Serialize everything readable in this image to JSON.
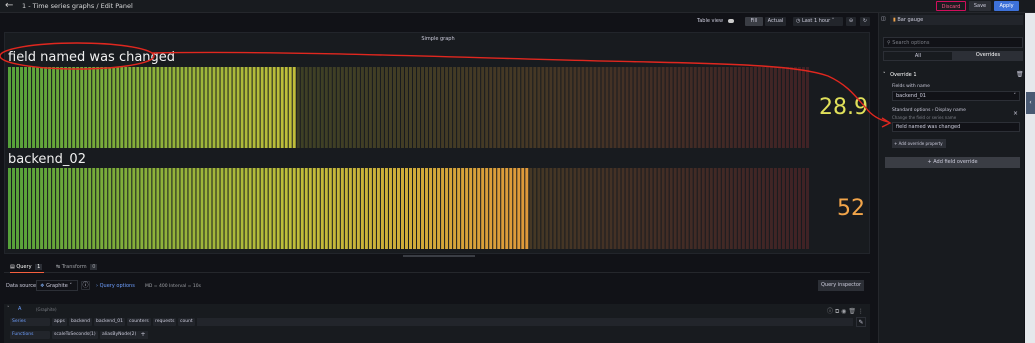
{
  "header": {
    "title": "1 - Time series graphs / Edit Panel",
    "discard": "Discard",
    "save": "Save",
    "apply": "Apply"
  },
  "toolbar": {
    "table_view": "Table view",
    "fill": "Fill",
    "actual": "Actual",
    "time_range": "Last 1 hour"
  },
  "panel": {
    "title": "Simple graph",
    "gauges": [
      {
        "label": "field named was changed",
        "value": "28.9",
        "value_color": "#e0e05a",
        "fill_fraction": 0.36
      },
      {
        "label": "backend_02",
        "value": "52",
        "value_color": "#f2a54a",
        "fill_fraction": 0.65
      }
    ]
  },
  "query_tabs": {
    "query": "Query",
    "query_count": "1",
    "transform": "Transform",
    "transform_count": "0"
  },
  "query": {
    "datasource_label": "Data source",
    "datasource": "Graphite",
    "query_options": "Query options",
    "md": "MD = 400",
    "interval": "Interval = 10s",
    "inspector": "Query inspector",
    "ref": "A",
    "ref_type": "(Graphite)",
    "series_label": "Series",
    "series": [
      "apps",
      "backend",
      "backend_01",
      "counters",
      "requests",
      "count"
    ],
    "functions_label": "Functions",
    "functions": [
      "scaleToSeconds(1)",
      "aliasByNode(2)"
    ]
  },
  "options_pane": {
    "visualization": "Bar gauge",
    "search_placeholder": "Search options",
    "tab_all": "All",
    "tab_overrides": "Overrides",
    "override_title": "Override 1",
    "fields_with_name": "Fields with name",
    "field_value": "backend_01",
    "property_path_a": "Standard options",
    "property_path_b": "Display name",
    "property_desc": "Change the field or series name",
    "display_name_value": "field named was changed",
    "add_override_property": "Add override property",
    "add_field_override": "Add field override"
  },
  "colors": {
    "accent": "#3d71d9",
    "discard": "#ff5286",
    "annotation": "#e0271f"
  }
}
